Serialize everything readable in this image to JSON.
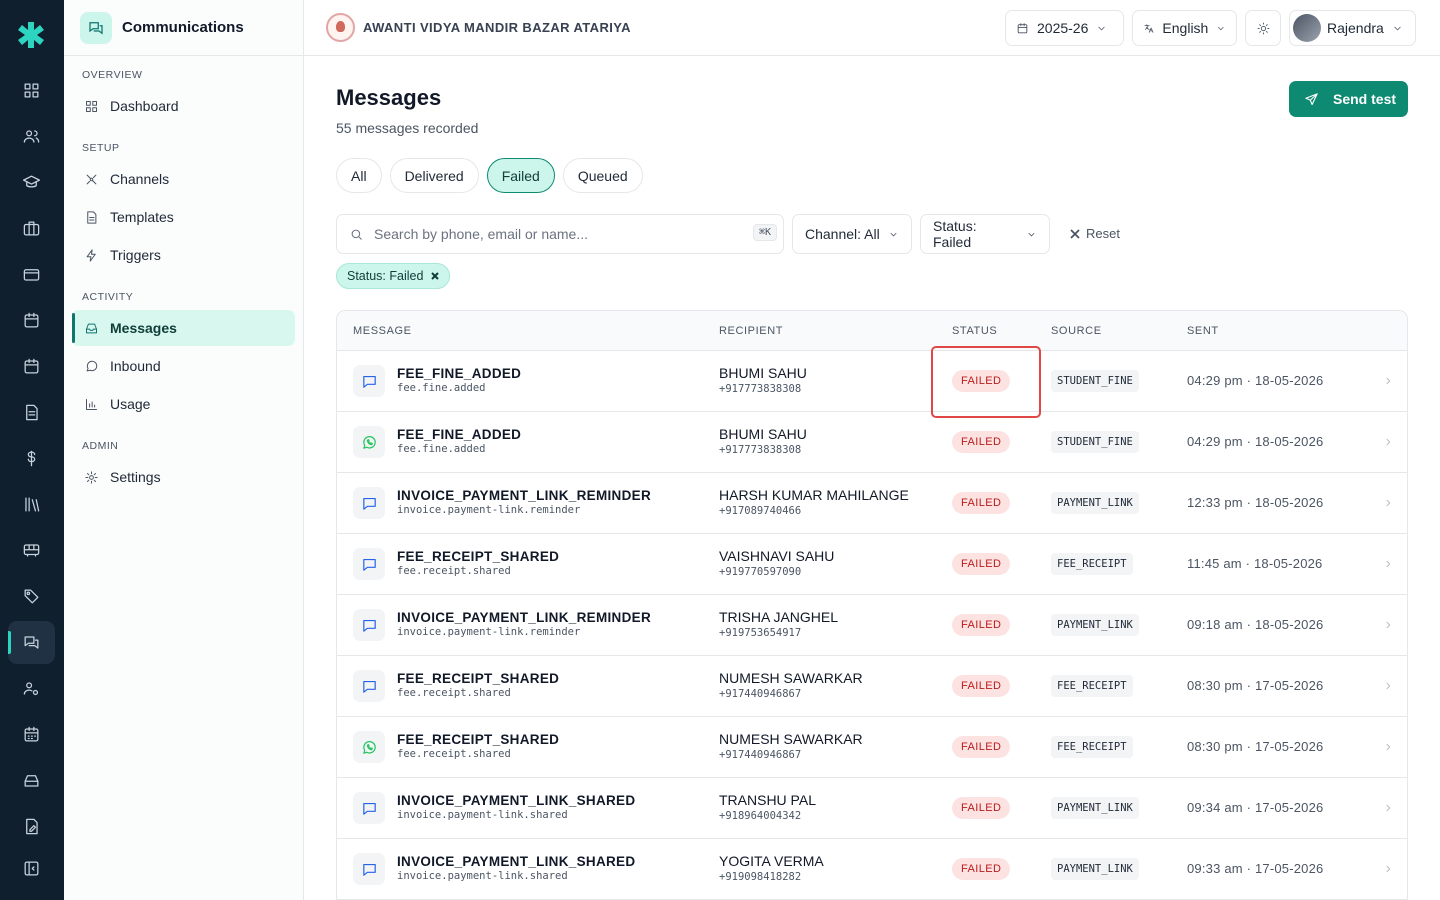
{
  "app": {
    "module_title": "Communications",
    "school_name": "AWANTI VIDYA MANDIR BAZAR ATARIYA",
    "year": "2025-26",
    "language": "English",
    "user": "Rajendra",
    "accent": "#0f8a72"
  },
  "rail_icons": [
    "dashboard-icon",
    "users-icon",
    "graduation-cap-icon",
    "briefcase-icon",
    "card-icon",
    "calendar-icon",
    "calendar-alt-icon",
    "document-icon",
    "dollar-icon",
    "library-icon",
    "bus-icon",
    "tag-icon",
    "chat-icon",
    "user-gear-icon",
    "calendar-grid-icon",
    "inbox-tray-icon",
    "file-edit-icon",
    "collapse-icon"
  ],
  "sidebar": {
    "groups": [
      {
        "label": "OVERVIEW",
        "items": [
          {
            "label": "Dashboard",
            "icon": "grid-icon"
          }
        ]
      },
      {
        "label": "SETUP",
        "items": [
          {
            "label": "Channels",
            "icon": "channels-icon"
          },
          {
            "label": "Templates",
            "icon": "file-icon"
          },
          {
            "label": "Triggers",
            "icon": "bolt-icon"
          }
        ]
      },
      {
        "label": "ACTIVITY",
        "items": [
          {
            "label": "Messages",
            "icon": "inbox-icon",
            "active": true
          },
          {
            "label": "Inbound",
            "icon": "message-circle-icon"
          },
          {
            "label": "Usage",
            "icon": "bar-chart-icon"
          }
        ]
      },
      {
        "label": "ADMIN",
        "items": [
          {
            "label": "Settings",
            "icon": "gear-icon"
          }
        ]
      }
    ]
  },
  "page": {
    "title": "Messages",
    "subtitle": "55 messages recorded",
    "send_test": "Send test",
    "tabs": [
      "All",
      "Delivered",
      "Failed",
      "Queued"
    ],
    "active_tab": "Failed",
    "search_placeholder": "Search by phone, email or name...",
    "search_shortcut": "⌘K",
    "channel_filter": "Channel: All",
    "status_filter": "Status: Failed",
    "reset": "Reset",
    "active_chip": "Status: Failed"
  },
  "table": {
    "columns": [
      "MESSAGE",
      "RECIPIENT",
      "STATUS",
      "SOURCE",
      "SENT"
    ],
    "rows": [
      {
        "channel": "sms",
        "name": "FEE_FINE_ADDED",
        "key": "fee.fine.added",
        "recipient": "BHUMI SAHU",
        "phone": "+917773838308",
        "status": "FAILED",
        "source": "STUDENT_FINE",
        "sent": "04:29 pm · 18-05-2026"
      },
      {
        "channel": "whatsapp",
        "name": "FEE_FINE_ADDED",
        "key": "fee.fine.added",
        "recipient": "BHUMI SAHU",
        "phone": "+917773838308",
        "status": "FAILED",
        "source": "STUDENT_FINE",
        "sent": "04:29 pm · 18-05-2026"
      },
      {
        "channel": "sms",
        "name": "INVOICE_PAYMENT_LINK_REMINDER",
        "key": "invoice.payment-link.reminder",
        "recipient": "HARSH KUMAR MAHILANGE",
        "phone": "+917089740466",
        "status": "FAILED",
        "source": "PAYMENT_LINK",
        "sent": "12:33 pm · 18-05-2026"
      },
      {
        "channel": "sms",
        "name": "FEE_RECEIPT_SHARED",
        "key": "fee.receipt.shared",
        "recipient": "VAISHNAVI SAHU",
        "phone": "+919770597090",
        "status": "FAILED",
        "source": "FEE_RECEIPT",
        "sent": "11:45 am · 18-05-2026"
      },
      {
        "channel": "sms",
        "name": "INVOICE_PAYMENT_LINK_REMINDER",
        "key": "invoice.payment-link.reminder",
        "recipient": "TRISHA JANGHEL",
        "phone": "+919753654917",
        "status": "FAILED",
        "source": "PAYMENT_LINK",
        "sent": "09:18 am · 18-05-2026"
      },
      {
        "channel": "sms",
        "name": "FEE_RECEIPT_SHARED",
        "key": "fee.receipt.shared",
        "recipient": "NUMESH SAWARKAR",
        "phone": "+917440946867",
        "status": "FAILED",
        "source": "FEE_RECEIPT",
        "sent": "08:30 pm · 17-05-2026"
      },
      {
        "channel": "whatsapp",
        "name": "FEE_RECEIPT_SHARED",
        "key": "fee.receipt.shared",
        "recipient": "NUMESH SAWARKAR",
        "phone": "+917440946867",
        "status": "FAILED",
        "source": "FEE_RECEIPT",
        "sent": "08:30 pm · 17-05-2026"
      },
      {
        "channel": "sms",
        "name": "INVOICE_PAYMENT_LINK_SHARED",
        "key": "invoice.payment-link.shared",
        "recipient": "TRANSHU PAL",
        "phone": "+918964004342",
        "status": "FAILED",
        "source": "PAYMENT_LINK",
        "sent": "09:34 am · 17-05-2026"
      },
      {
        "channel": "sms",
        "name": "INVOICE_PAYMENT_LINK_SHARED",
        "key": "invoice.payment-link.shared",
        "recipient": "YOGITA VERMA",
        "phone": "+919098418282",
        "status": "FAILED",
        "source": "PAYMENT_LINK",
        "sent": "09:33 am · 17-05-2026"
      }
    ]
  }
}
